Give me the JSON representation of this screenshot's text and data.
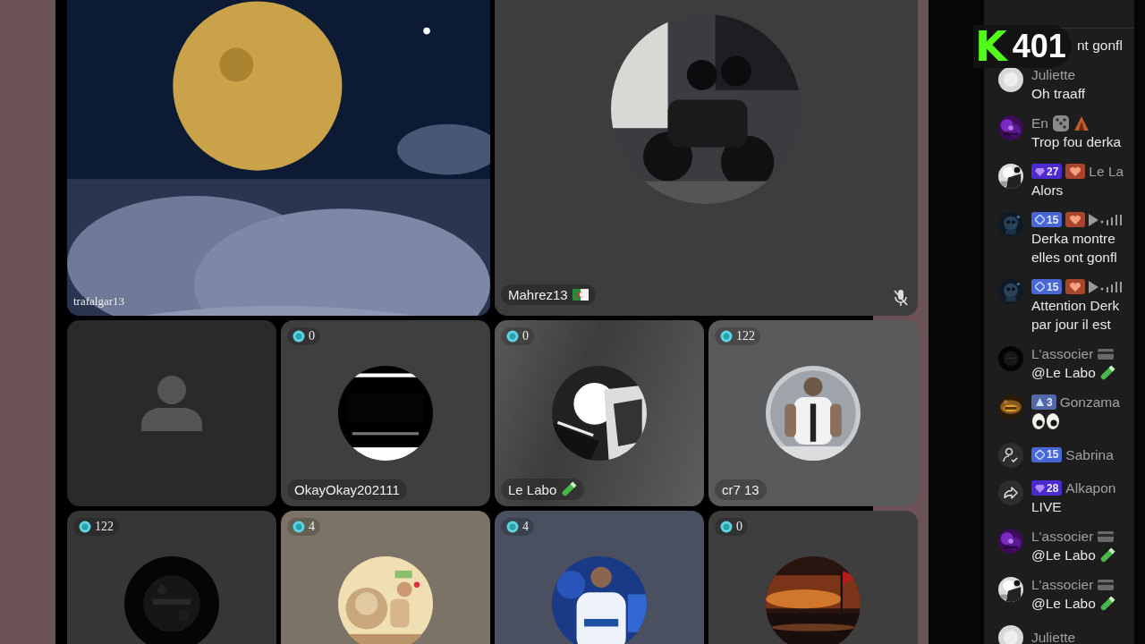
{
  "stage": {
    "featured": [
      {
        "kind": "video",
        "name": "trafalgar13"
      },
      {
        "kind": "avatar",
        "name": "Mahrez13",
        "muted": true
      }
    ],
    "guests": [
      {
        "kind": "empty"
      },
      {
        "kind": "avatar",
        "score": "0",
        "name": "OkayOkay202111"
      },
      {
        "kind": "avatar",
        "score": "0",
        "name": "Le Labo"
      },
      {
        "kind": "avatar",
        "score": "122",
        "name": "cr7 13"
      },
      {
        "kind": "avatar",
        "score": "122"
      },
      {
        "kind": "avatar",
        "score": "4"
      },
      {
        "kind": "avatar",
        "score": "4"
      },
      {
        "kind": "avatar",
        "score": "0"
      }
    ]
  },
  "viewers": {
    "logo": "K",
    "count": "401"
  },
  "chat": [
    {
      "kind": "cut",
      "lines": [
        "nt gonfl"
      ]
    },
    {
      "kind": "default",
      "name": "Juliette",
      "lines": [
        "Oh traaff"
      ]
    },
    {
      "kind": "comment",
      "name": "En",
      "lines": [
        "Trop fou derka"
      ]
    },
    {
      "kind": "comment",
      "badge": {
        "kind": "gem",
        "value": "27"
      },
      "fan": true,
      "name": "Le La",
      "lines": [
        "Alors"
      ]
    },
    {
      "kind": "comment",
      "badge": {
        "kind": "diamond",
        "value": "15"
      },
      "fan": true,
      "audio": true,
      "lines": [
        "Derka montre",
        "elles ont gonfl"
      ]
    },
    {
      "kind": "comment",
      "badge": {
        "kind": "diamond",
        "value": "15"
      },
      "fan": true,
      "audio": true,
      "lines": [
        "Attention Derk",
        "par jour il est"
      ]
    },
    {
      "kind": "comment",
      "name": "L'associer",
      "lines": [
        "@Le Labo"
      ]
    },
    {
      "kind": "comment",
      "badge": {
        "kind": "triangle",
        "value": "3"
      },
      "name": "Gonzama"
    },
    {
      "kind": "follow",
      "badge": {
        "kind": "diamond",
        "value": "15"
      },
      "name": "Sabrina"
    },
    {
      "kind": "share",
      "badge": {
        "kind": "gem",
        "value": "28"
      },
      "name": "Alkapon",
      "lines": [
        "LIVE"
      ]
    },
    {
      "kind": "comment",
      "name": "L'associer",
      "lines": [
        "@Le Labo"
      ]
    },
    {
      "kind": "comment",
      "name": "L'associer",
      "lines": [
        "@Le Labo"
      ]
    },
    {
      "kind": "default",
      "name": "Juliette"
    }
  ]
}
